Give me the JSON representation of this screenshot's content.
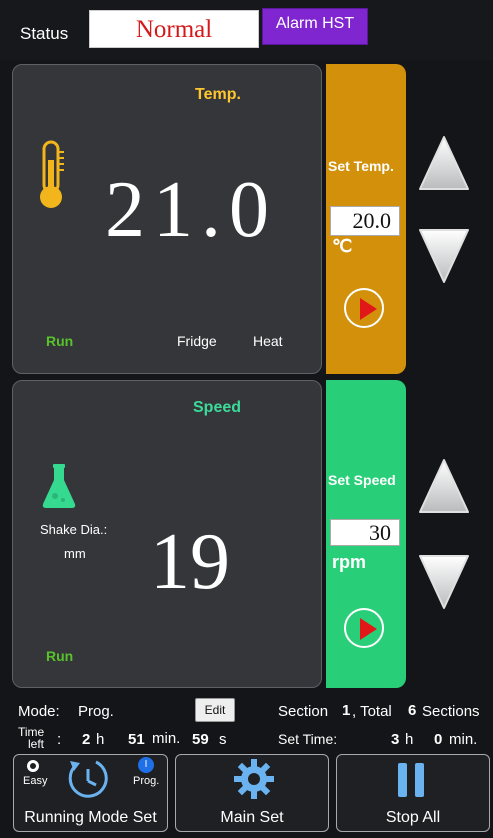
{
  "status": {
    "label": "Status",
    "value": "Normal",
    "alarm_button": "Alarm HST"
  },
  "temperature": {
    "title": "Temp.",
    "current_value": "21.0",
    "run_label": "Run",
    "fridge_label": "Fridge",
    "heat_label": "Heat",
    "set_title": "Set Temp.",
    "set_value": "20.0",
    "unit": "℃",
    "icon": "thermometer-icon"
  },
  "speed": {
    "title": "Speed",
    "current_value": "19",
    "run_label": "Run",
    "shake_dia_label": "Shake Dia.:",
    "shake_dia_unit": "mm",
    "set_title": "Set Speed",
    "set_value": "30",
    "unit": "rpm",
    "icon": "flask-icon"
  },
  "info": {
    "mode_label": "Mode:",
    "mode_value": "Prog.",
    "edit_button": "Edit",
    "section_label": "Section",
    "section_value": "1",
    "total_label": ", Total",
    "total_value": "6",
    "sections_label": "Sections",
    "time_left_line1": "Time",
    "time_left_line2": "left",
    "colon": ":",
    "hours_value": "2",
    "hours_unit": "h",
    "minutes_value": "51",
    "minutes_unit": "min.",
    "seconds_value": "59",
    "seconds_unit": "s",
    "set_time_label": "Set Time:",
    "set_time_hours": "3",
    "set_time_hours_unit": "h",
    "set_time_minutes": "0",
    "set_time_minutes_unit": "min."
  },
  "footer": {
    "running_mode": {
      "label": "Running Mode Set",
      "easy": "Easy",
      "prog": "Prog."
    },
    "main_set": {
      "label": "Main Set"
    },
    "stop_all": {
      "label": "Stop All"
    }
  },
  "colors": {
    "temp_accent": "#d2900b",
    "speed_accent": "#29cf78",
    "alarm": "#7f26d1",
    "status_text": "#d31919"
  }
}
